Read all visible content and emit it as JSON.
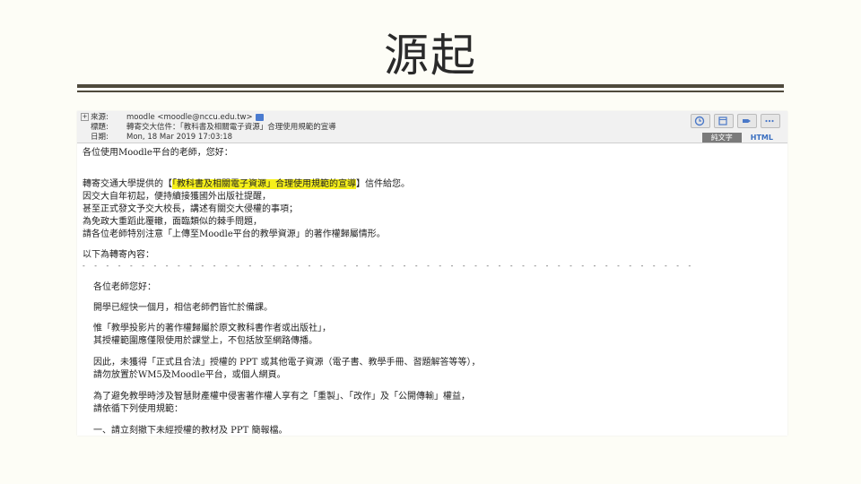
{
  "slide": {
    "title": "源起"
  },
  "email": {
    "header": {
      "from_label": "來源:",
      "from_value": "moodle <moodle@nccu.edu.tw>",
      "subject_label": "標題:",
      "subject_value": "轉寄交大信件：「教科書及相關電子資源」合理使用規範的宣導",
      "date_label": "日期:",
      "date_value": "Mon, 18 Mar 2019 17:03:18",
      "tab_plain": "純文字",
      "tab_html": "HTML",
      "tool_icons": [
        "clock-icon",
        "calendar-icon",
        "tag-icon",
        "more-icon"
      ]
    },
    "body": {
      "greeting": "各位使用Moodle平台的老師，您好：",
      "fwd_prefix": "轉寄交通大學提供的【",
      "fwd_highlight": "「教科書及相關電子資源」合理使用規範的宣導",
      "fwd_suffix": "】信件給您。",
      "reason_lines": [
        "因交大自年初起，便持續接獲國外出版社提醒，",
        "甚至正式發文予交大校長，講述有關交大侵權的事項；",
        "為免政大重蹈此覆轍，面臨類似的棘手問題，",
        "請各位老師特別注意「上傳至Moodle平台的教學資源」的著作權歸屬情形。"
      ],
      "forward_intro": "以下為轉寄內容：",
      "divider": "- - - - - - - - - - - - - - - - - - - - - - - - - - - - - - - - - - - - - - - - - - - - - - - - - - - -",
      "inner_greeting": "各位老師您好：",
      "para1": "開學已經快一個月，相信老師們皆忙於備課。",
      "para2": [
        "惟「教學投影片的著作權歸屬於原文教科書作者或出版社」，",
        "其授權範圍應僅限使用於課堂上，不包括放至網路傳播。"
      ],
      "para3": [
        "因此，未獲得「正式且合法」授權的 PPT 或其他電子資源（電子書、教學手冊、習題解答等等），",
        "請勿放置於WM5及Moodle平台，或個人網頁。"
      ],
      "para4": [
        "為了避免教學時涉及智慧財產權中侵害著作權人享有之「重製」、「改作」及「公開傳輸」權益，",
        "請依循下列使用規範："
      ],
      "rule1": "一、請立刻撤下未經授權的教材及 PPT 簡報檔。"
    }
  }
}
